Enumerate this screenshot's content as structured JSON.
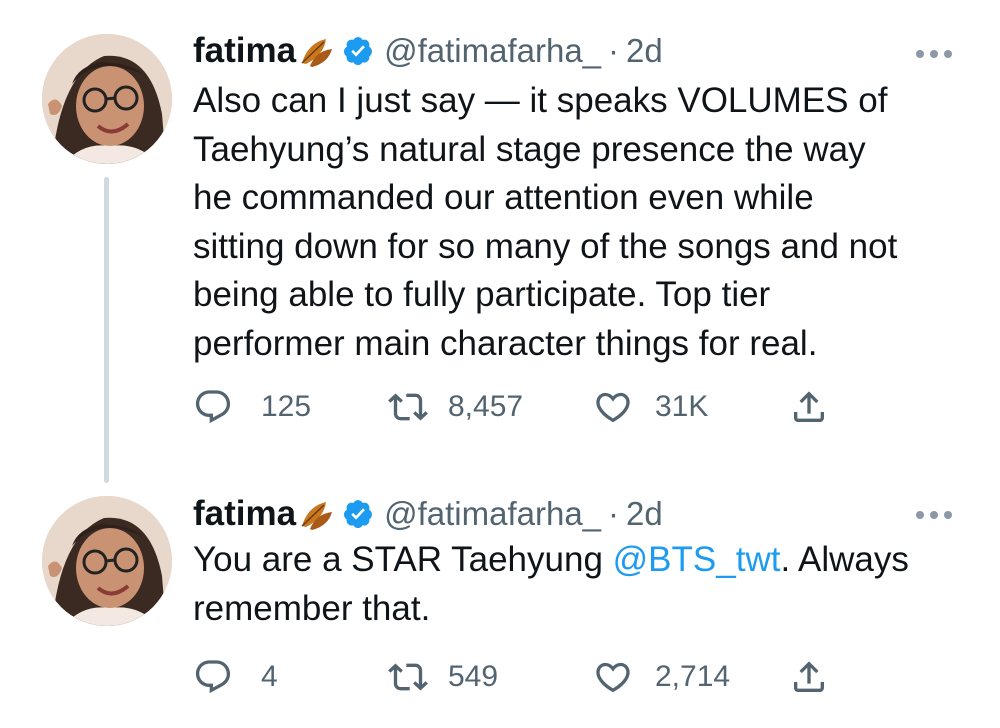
{
  "tweets": [
    {
      "display_name": "fatima",
      "handle": "@fatimafarha_",
      "separator": "·",
      "time": "2d",
      "lines": [
        "Also can I just say — it speaks VOLUMES of",
        "Taehyung’s natural stage presence the way",
        "he commanded our attention even while",
        "sitting down for so many of the songs and not",
        "being able to fully participate. Top tier",
        "performer main character things for real."
      ],
      "actions": {
        "replies": "125",
        "retweets": "8,457",
        "likes": "31K"
      }
    },
    {
      "display_name": "fatima",
      "handle": "@fatimafarha_",
      "separator": "·",
      "time": "2d",
      "line1_before": "You are a STAR Taehyung ",
      "line1_mention": "@BTS_twt",
      "line1_after": ". Always",
      "line2": "remember that.",
      "actions": {
        "replies": "4",
        "retweets": "549",
        "likes": "2,714"
      }
    }
  ],
  "colors": {
    "text": "#0f1419",
    "secondary": "#536471",
    "link": "#1d9bf0",
    "verified": "#1d9bf0",
    "thread_line": "#cfd9de"
  },
  "icons": {
    "emoji": "fallen-leaf-icon",
    "verified": "verified-badge-icon",
    "more": "more-options-icon",
    "reply": "reply-icon",
    "retweet": "retweet-icon",
    "like": "heart-icon",
    "share": "share-icon"
  }
}
